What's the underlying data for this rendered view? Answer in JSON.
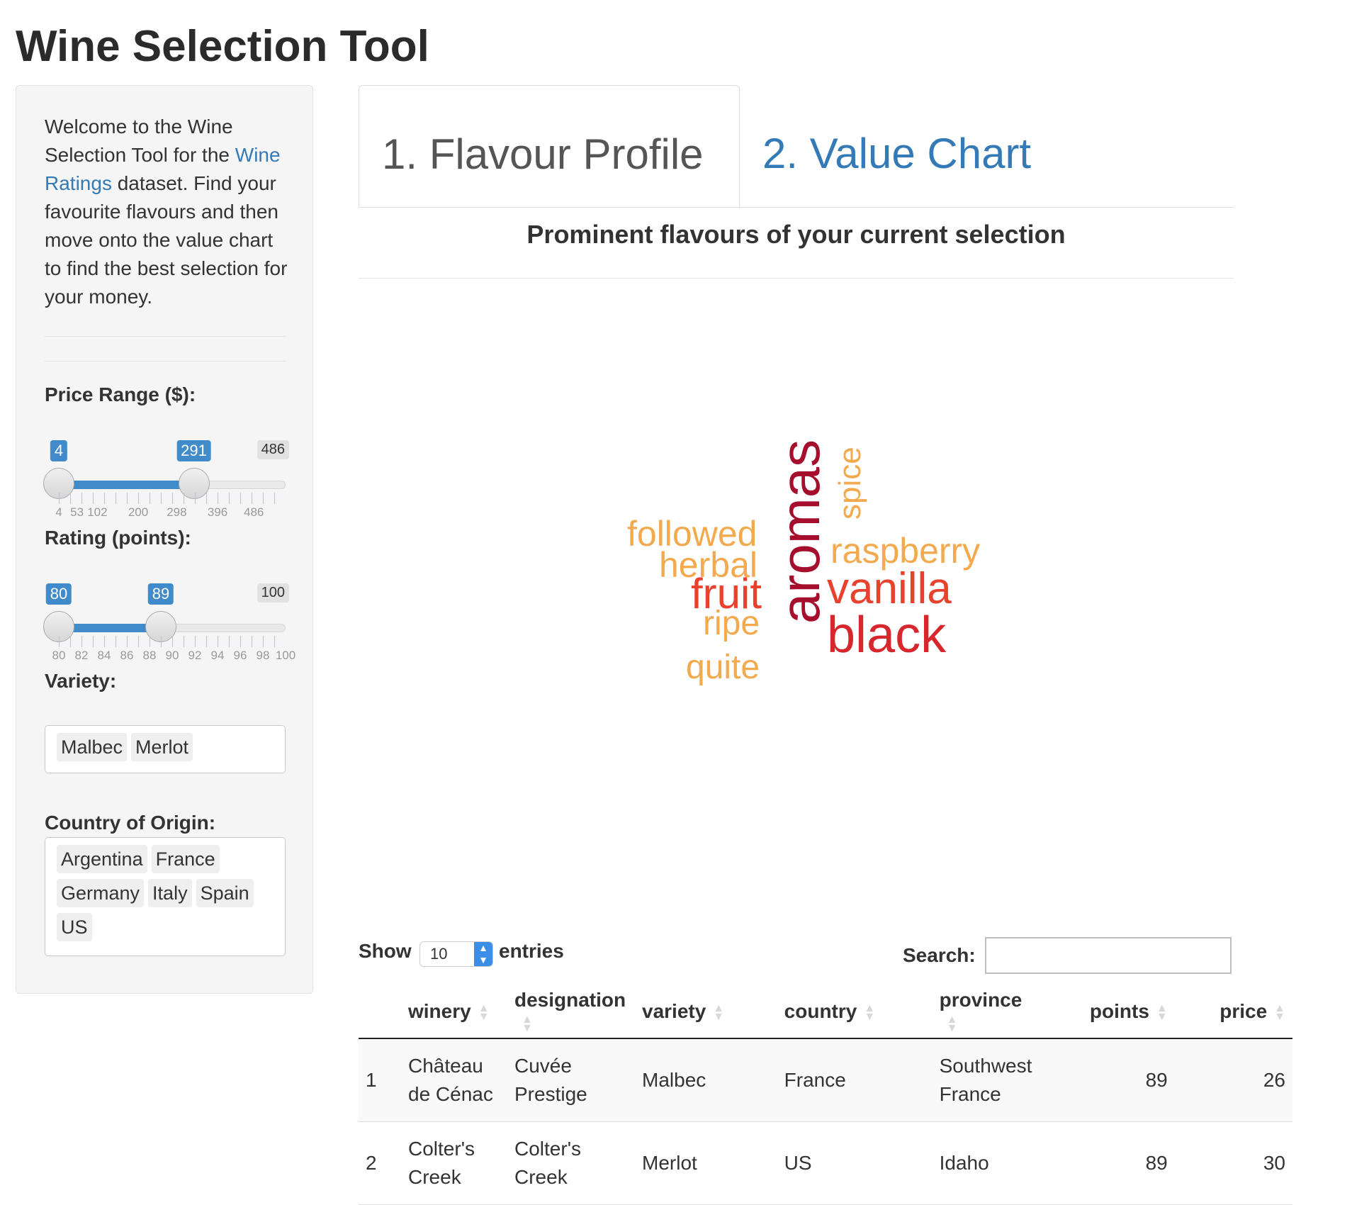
{
  "app": {
    "title": "Wine Selection Tool"
  },
  "sidebar": {
    "intro_prefix": "Welcome to the Wine Selection Tool for the ",
    "intro_link": "Wine Ratings",
    "intro_suffix": " dataset. Find your favourite flavours and then move onto the value chart to find the best selection for your money.",
    "price": {
      "label": "Price Range ($):",
      "min": 4,
      "max": 486,
      "low": 291,
      "from": 4,
      "to": 291,
      "from_label": "4",
      "to_label": "291",
      "max_label": "486",
      "ticks": [
        "4",
        "53",
        "102",
        "200",
        "298",
        "396",
        "486"
      ]
    },
    "rating": {
      "label": "Rating (points):",
      "min": 80,
      "max": 100,
      "from": 80,
      "to": 89,
      "from_label": "80",
      "to_label": "89",
      "max_label": "100",
      "ticks": [
        "80",
        "82",
        "84",
        "86",
        "88",
        "90",
        "92",
        "94",
        "96",
        "98",
        "100"
      ]
    },
    "variety": {
      "label": "Variety:",
      "selected": [
        "Malbec",
        "Merlot"
      ]
    },
    "country": {
      "label": "Country of Origin:",
      "selected": [
        "Argentina",
        "France",
        "Germany",
        "Italy",
        "Spain",
        "US"
      ]
    }
  },
  "tabs": [
    {
      "label": "1. Flavour Profile",
      "active": true
    },
    {
      "label": "2. Value Chart",
      "active": false
    }
  ],
  "main": {
    "subtitle": "Prominent flavours of your current selection",
    "wordcloud": [
      {
        "word": "aromas",
        "color": "#a50f2d"
      },
      {
        "word": "black",
        "color": "#d7262c"
      },
      {
        "word": "vanilla",
        "color": "#e8412e"
      },
      {
        "word": "fruit",
        "color": "#e8412e"
      },
      {
        "word": "raspberry",
        "color": "#f3a94e"
      },
      {
        "word": "followed",
        "color": "#f3a94e"
      },
      {
        "word": "herbal",
        "color": "#f3a94e"
      },
      {
        "word": "ripe",
        "color": "#f3a94e"
      },
      {
        "word": "quite",
        "color": "#f3a94e"
      },
      {
        "word": "spice",
        "color": "#f3a94e"
      }
    ]
  },
  "datatable": {
    "show_label": "Show",
    "page_length": "10",
    "entries_label": "entries",
    "search_label": "Search:",
    "search_value": "",
    "columns": [
      "",
      "winery",
      "designation",
      "variety",
      "country",
      "province",
      "points",
      "price"
    ],
    "rows": [
      [
        "1",
        "Château de Cénac",
        "Cuvée Prestige",
        "Malbec",
        "France",
        "Southwest France",
        "89",
        "26"
      ],
      [
        "2",
        "Colter's Creek",
        "Colter's Creek",
        "Merlot",
        "US",
        "Idaho",
        "89",
        "30"
      ]
    ]
  }
}
